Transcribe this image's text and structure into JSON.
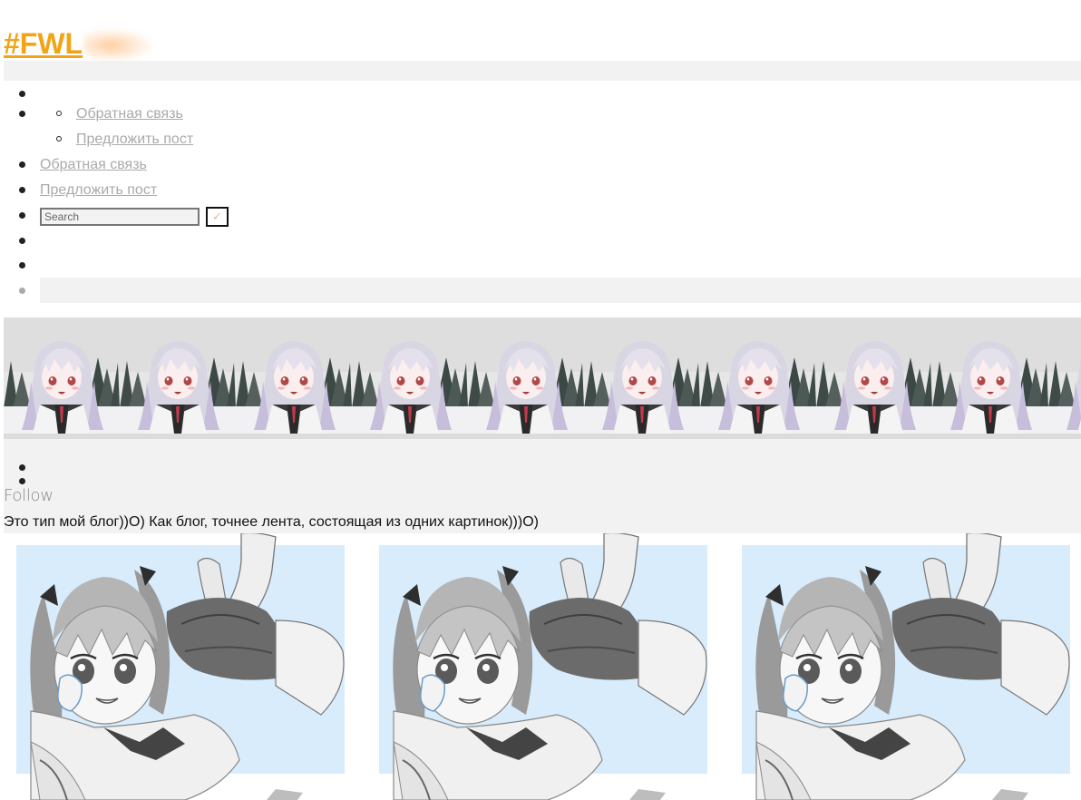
{
  "header": {
    "site_title": "#FWL"
  },
  "nav": {
    "submenu": [
      {
        "label": "Обратная связь"
      },
      {
        "label": "Предложить пост"
      }
    ],
    "items": [
      {
        "label": "Обратная связь"
      },
      {
        "label": "Предложить пост"
      }
    ]
  },
  "search": {
    "placeholder": "Search",
    "submit_glyph": "✓"
  },
  "profile": {
    "follow_label": "Follow",
    "description": "Это тип мой блог))О) Как блог, точнее лента, состоящая из одних картинок)))О)"
  },
  "banner": {
    "tile_count": 10,
    "image": "anime-girl-snowy-forest"
  },
  "posts": [
    {
      "image": "anime-girl-lying-sailor-uniform"
    },
    {
      "image": "anime-girl-lying-sailor-uniform"
    },
    {
      "image": "anime-girl-lying-sailor-uniform"
    }
  ],
  "colors": {
    "accent": "#f2a414",
    "link": "#aaaaaa",
    "panel": "#f2f2f2",
    "post_bg": "#d8ecfc"
  }
}
